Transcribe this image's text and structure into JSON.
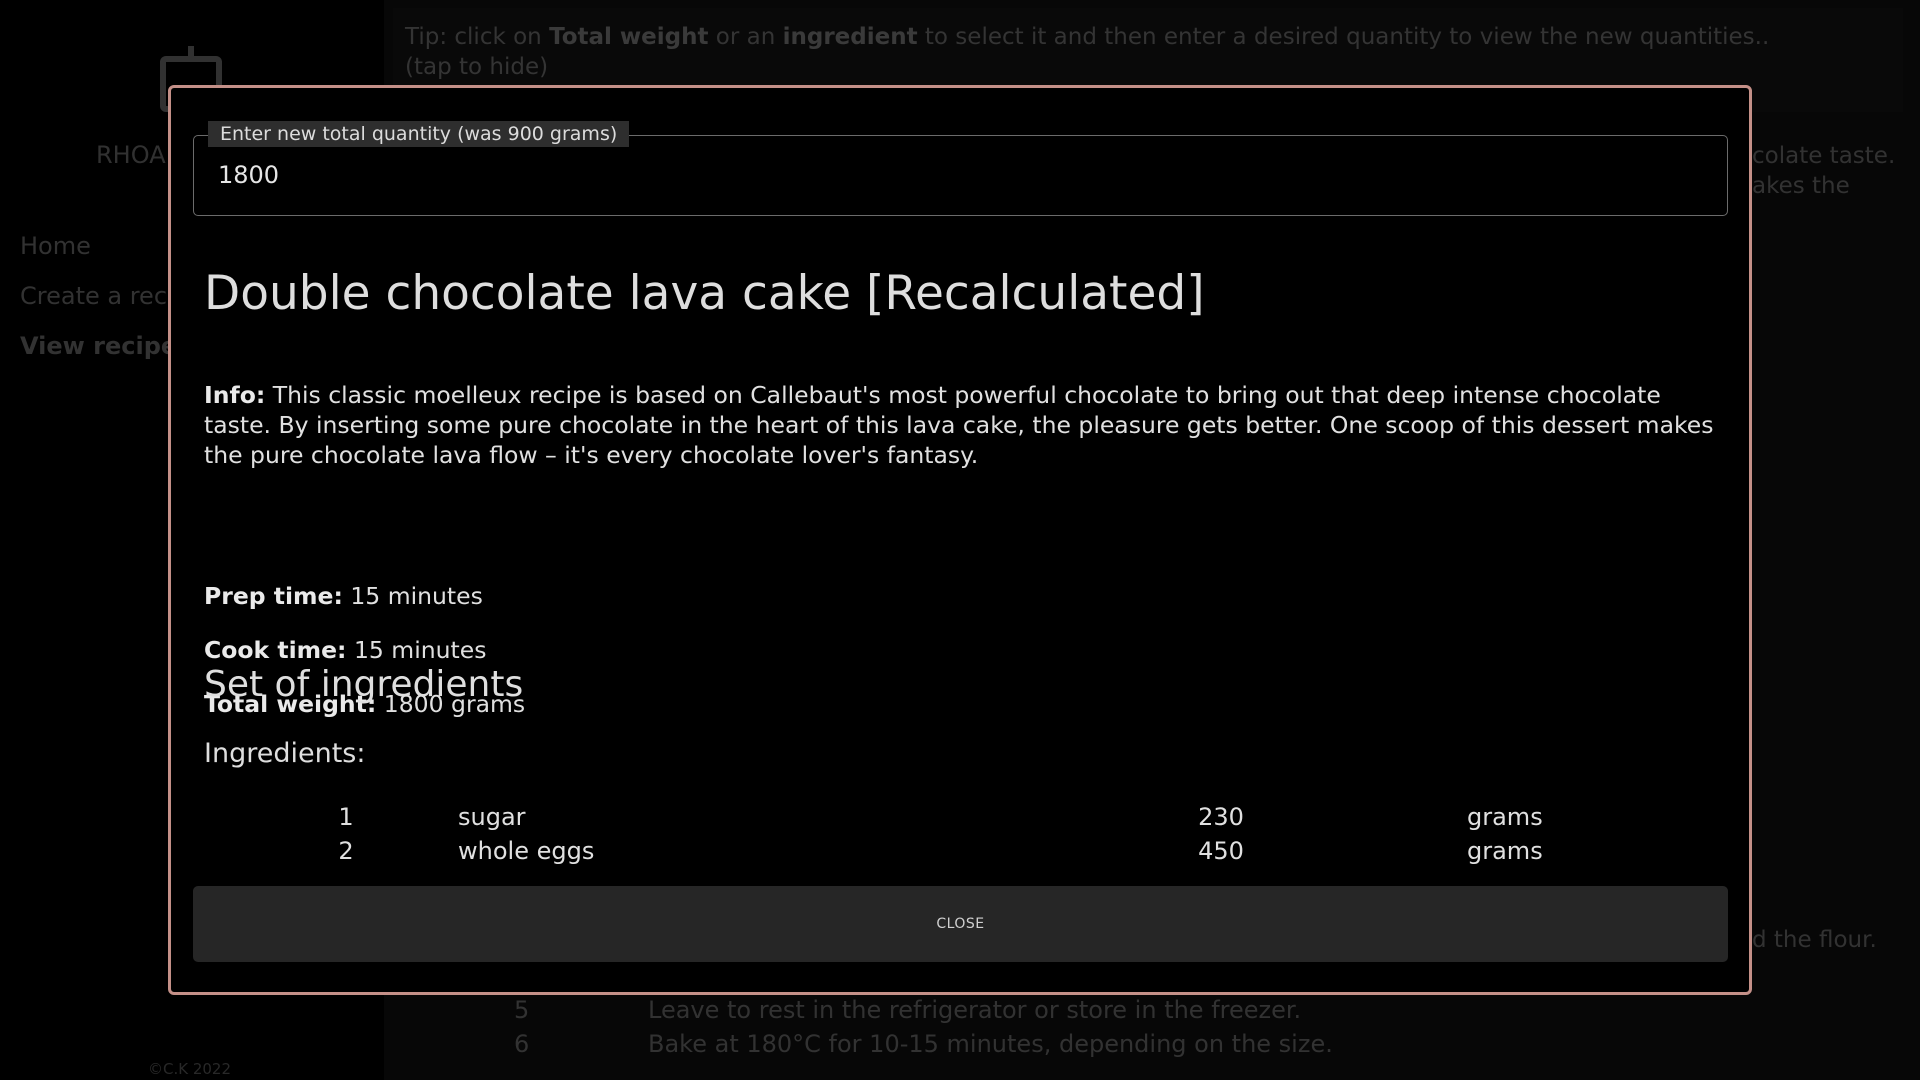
{
  "sidebar": {
    "brand": "RHOA",
    "nav": [
      "Home",
      "Create a reci",
      "View recipes"
    ],
    "copyright": "©C.K 2022"
  },
  "background": {
    "tip_prefix": "Tip: click on ",
    "tip_total_weight": "Total weight",
    "tip_or": " or an ",
    "tip_ingredient": "ingredient",
    "tip_suffix": " to select it and then enter a desired quantity to view the new quantities..",
    "tip_hide": "(tap to hide)",
    "peek_line_1": "colate taste.",
    "peek_line_2": "akes the",
    "peek_line_3": "d the flour.",
    "steps": [
      {
        "num": "5",
        "text": "Leave to rest in the refrigerator or store in the freezer."
      },
      {
        "num": "6",
        "text": "Bake at 180°C for 10-15 minutes, depending on the size."
      }
    ]
  },
  "modal": {
    "field_label": "Enter new total quantity (was 900 grams)",
    "field_value": "1800",
    "title": "Double chocolate lava cake [Recalculated]",
    "info_label": "Info:",
    "info_text": " This classic moelleux recipe is based on Callebaut's most powerful chocolate to bring out that deep intense chocolate taste. By inserting some pure chocolate in the heart of this lava cake, the pleasure gets better. One scoop of this dessert makes the pure chocolate lava flow – it's every chocolate lover's fantasy.",
    "prep_label": "Prep time:",
    "prep_value": " 15 minutes",
    "cook_label": "Cook time:",
    "cook_value": " 15 minutes",
    "weight_label": "Total weight:",
    "weight_value": " 1800 grams",
    "set_heading": "Set of ingredients",
    "ingredients_label": "Ingredients:",
    "ingredients": [
      {
        "num": "1",
        "name": "sugar",
        "qty": "230",
        "unit": "grams"
      },
      {
        "num": "2",
        "name": "whole eggs",
        "qty": "450",
        "unit": "grams"
      }
    ],
    "close_label": "CLOSE"
  },
  "colors": {
    "modal_border": "#c49088",
    "modal_bg": "#000000",
    "close_bg": "#262626"
  }
}
